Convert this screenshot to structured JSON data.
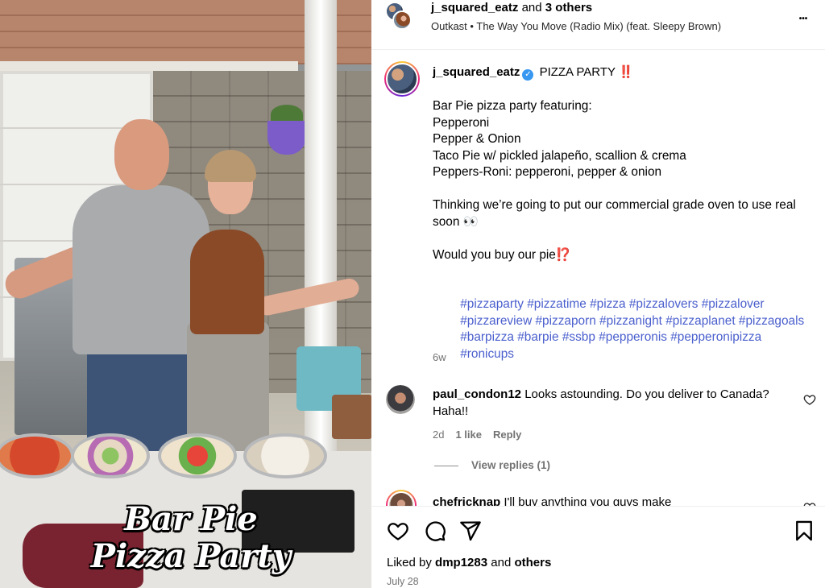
{
  "header": {
    "username": "j_squared_eatz",
    "and_text": "and",
    "others_text": "3 others",
    "audio_artist": "Outkast",
    "audio_sep": "•",
    "audio_track": "The Way You Move (Radio Mix) (feat. Sleepy Brown)",
    "more_label": "•••"
  },
  "media": {
    "overlay_line1": "Bar Pie",
    "overlay_line2": "Pizza Party"
  },
  "caption": {
    "username": "j_squared_eatz",
    "verified_mark": "✓",
    "title": "PIZZA PARTY ‼️",
    "lines": [
      "Bar Pie pizza party featuring:",
      "Pepperoni",
      "Pepper & Onion",
      "Taco Pie w/ pickled jalapeño, scallion & crema",
      "Peppers-Roni: pepperoni, pepper & onion"
    ],
    "para2": "Thinking we’re going to put our commercial grade oven to use real soon 👀",
    "para3": "Would you buy our pie⁉️",
    "hashtags": [
      "#pizzaparty",
      "#pizzatime",
      "#pizza",
      "#pizzalovers",
      "#pizzalover",
      "#pizzareview",
      "#pizzaporn",
      "#pizzanight",
      "#pizzaplanet",
      "#pizzagoals",
      "#barpizza",
      "#barpie",
      "#ssbp",
      "#pepperonis",
      "#pepperonipizza",
      "#ronicups"
    ],
    "time": "6w"
  },
  "comments": [
    {
      "username": "paul_condon12",
      "text": "Looks astounding. Do you deliver to Canada? Haha!!",
      "time": "2d",
      "likes": "1 like",
      "reply": "Reply",
      "view_replies": "View replies (1)"
    },
    {
      "username": "chefricknap",
      "text": "I'll buy anything you guys make"
    }
  ],
  "actions": {
    "liked_by_prefix": "Liked by",
    "liked_by_user": "dmp1283",
    "liked_by_and": "and",
    "liked_by_others": "others",
    "date": "July 28"
  },
  "icons": {
    "like": "heart-icon",
    "comment": "comment-icon",
    "share": "share-icon",
    "save": "bookmark-icon",
    "more": "more-horizontal-icon",
    "verified": "verified-badge-icon"
  },
  "colors": {
    "hashtag": "#4a5fcd",
    "verified": "#3897f0",
    "muted": "#737373",
    "overlay_text": "#ffffff"
  }
}
